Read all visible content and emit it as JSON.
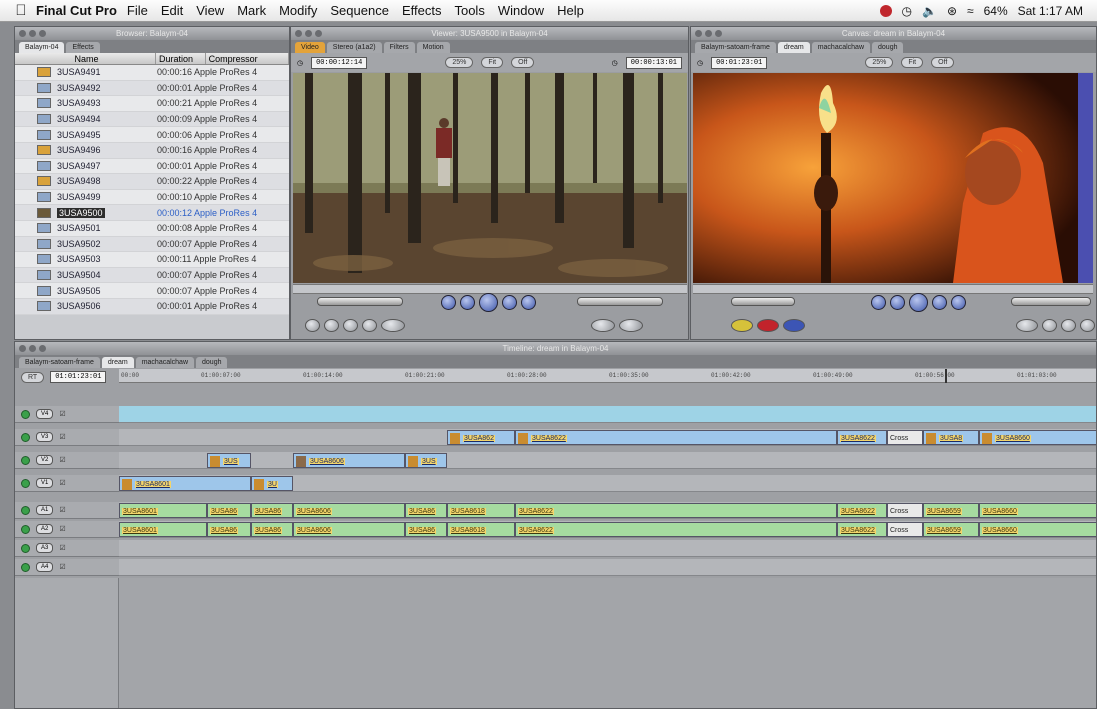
{
  "menubar": {
    "app_name": "Final Cut Pro",
    "items": [
      "File",
      "Edit",
      "View",
      "Mark",
      "Modify",
      "Sequence",
      "Effects",
      "Tools",
      "Window",
      "Help"
    ],
    "battery": "64%",
    "clock": "Sat 1:17 AM"
  },
  "browser": {
    "title": "Browser: Balaym-04",
    "tabs": [
      "Balaym-04",
      "Effects"
    ],
    "columns": [
      "Name",
      "Duration",
      "Compressor"
    ],
    "rows": [
      {
        "name": "3USA9491",
        "duration": "00:00:16 Apple ProRes 4"
      },
      {
        "name": "3USA9492",
        "duration": "00:00:01 Apple ProRes 4"
      },
      {
        "name": "3USA9493",
        "duration": "00:00:21 Apple ProRes 4"
      },
      {
        "name": "3USA9494",
        "duration": "00:00:09 Apple ProRes 4"
      },
      {
        "name": "3USA9495",
        "duration": "00:00:06 Apple ProRes 4"
      },
      {
        "name": "3USA9496",
        "duration": "00:00:16 Apple ProRes 4"
      },
      {
        "name": "3USA9497",
        "duration": "00:00:01 Apple ProRes 4"
      },
      {
        "name": "3USA9498",
        "duration": "00:00:22 Apple ProRes 4"
      },
      {
        "name": "3USA9499",
        "duration": "00:00:10 Apple ProRes 4"
      },
      {
        "name": "3USA9500",
        "duration": "00:00:12 Apple ProRes 4"
      },
      {
        "name": "3USA9501",
        "duration": "00:00:08 Apple ProRes 4"
      },
      {
        "name": "3USA9502",
        "duration": "00:00:07 Apple ProRes 4"
      },
      {
        "name": "3USA9503",
        "duration": "00:00:11 Apple ProRes 4"
      },
      {
        "name": "3USA9504",
        "duration": "00:00:07 Apple ProRes 4"
      },
      {
        "name": "3USA9505",
        "duration": "00:00:07 Apple ProRes 4"
      },
      {
        "name": "3USA9506",
        "duration": "00:00:01 Apple ProRes 4"
      }
    ]
  },
  "viewer": {
    "title": "Viewer: 3USA9500 in Balaym-04",
    "tabs": [
      "Video",
      "Stereo (a1a2)",
      "Filters",
      "Motion"
    ],
    "duration_tc": "00:00:12:14",
    "current_tc": "00:00:13:01",
    "zoom": "25%",
    "view": "Fit",
    "overlay": "Off"
  },
  "canvas": {
    "title": "Canvas: dream in Balaym-04",
    "tabs": [
      "Balaym-satoam-frame",
      "dream",
      "machacalchaw",
      "dough"
    ],
    "duration_tc": "00:01:23:01",
    "zoom": "25%",
    "view": "Fit",
    "overlay": "Off"
  },
  "timeline": {
    "title": "Timeline: dream in Balaym-04",
    "tabs": [
      "Balaym-satoam-frame",
      "dream",
      "machacalchaw",
      "dough"
    ],
    "rt": "RT",
    "current_tc": "01:01:23:01",
    "ruler": [
      "00:00",
      "01:00:07:00",
      "01:00:14:00",
      "01:00:21:00",
      "01:00:28:00",
      "01:00:35:00",
      "01:00:42:00",
      "01:00:49:00",
      "01:00:56:00",
      "01:01:03:00"
    ],
    "tracks": [
      {
        "label": "V4",
        "clips": []
      },
      {
        "label": "V3",
        "clips": [
          "3USA862",
          "3USA8622",
          "3USA8622",
          "Cross",
          "3USA8",
          "3USA8660"
        ]
      },
      {
        "label": "V2",
        "patch": "v1",
        "clips": [
          "3US",
          "3USA8606",
          "3US"
        ]
      },
      {
        "label": "V1",
        "clips": [
          "3USA8601",
          "3U"
        ]
      },
      {
        "label": "A1",
        "patch": "a1",
        "clips": [
          "3USA8601",
          "3USA86",
          "3USA86",
          "3USA8606",
          "3USA86",
          "3USA8618",
          "3USA8622",
          "3USA8622",
          "Cross",
          "3USA8659",
          "3USA8660"
        ]
      },
      {
        "label": "A2",
        "patch": "a2",
        "clips": [
          "3USA8601",
          "3USA86",
          "3USA86",
          "3USA8606",
          "3USA86",
          "3USA8618",
          "3USA8622",
          "3USA8622",
          "Cross",
          "3USA8659",
          "3USA8660"
        ]
      },
      {
        "label": "A3",
        "clips": []
      },
      {
        "label": "A4",
        "clips": []
      }
    ]
  }
}
